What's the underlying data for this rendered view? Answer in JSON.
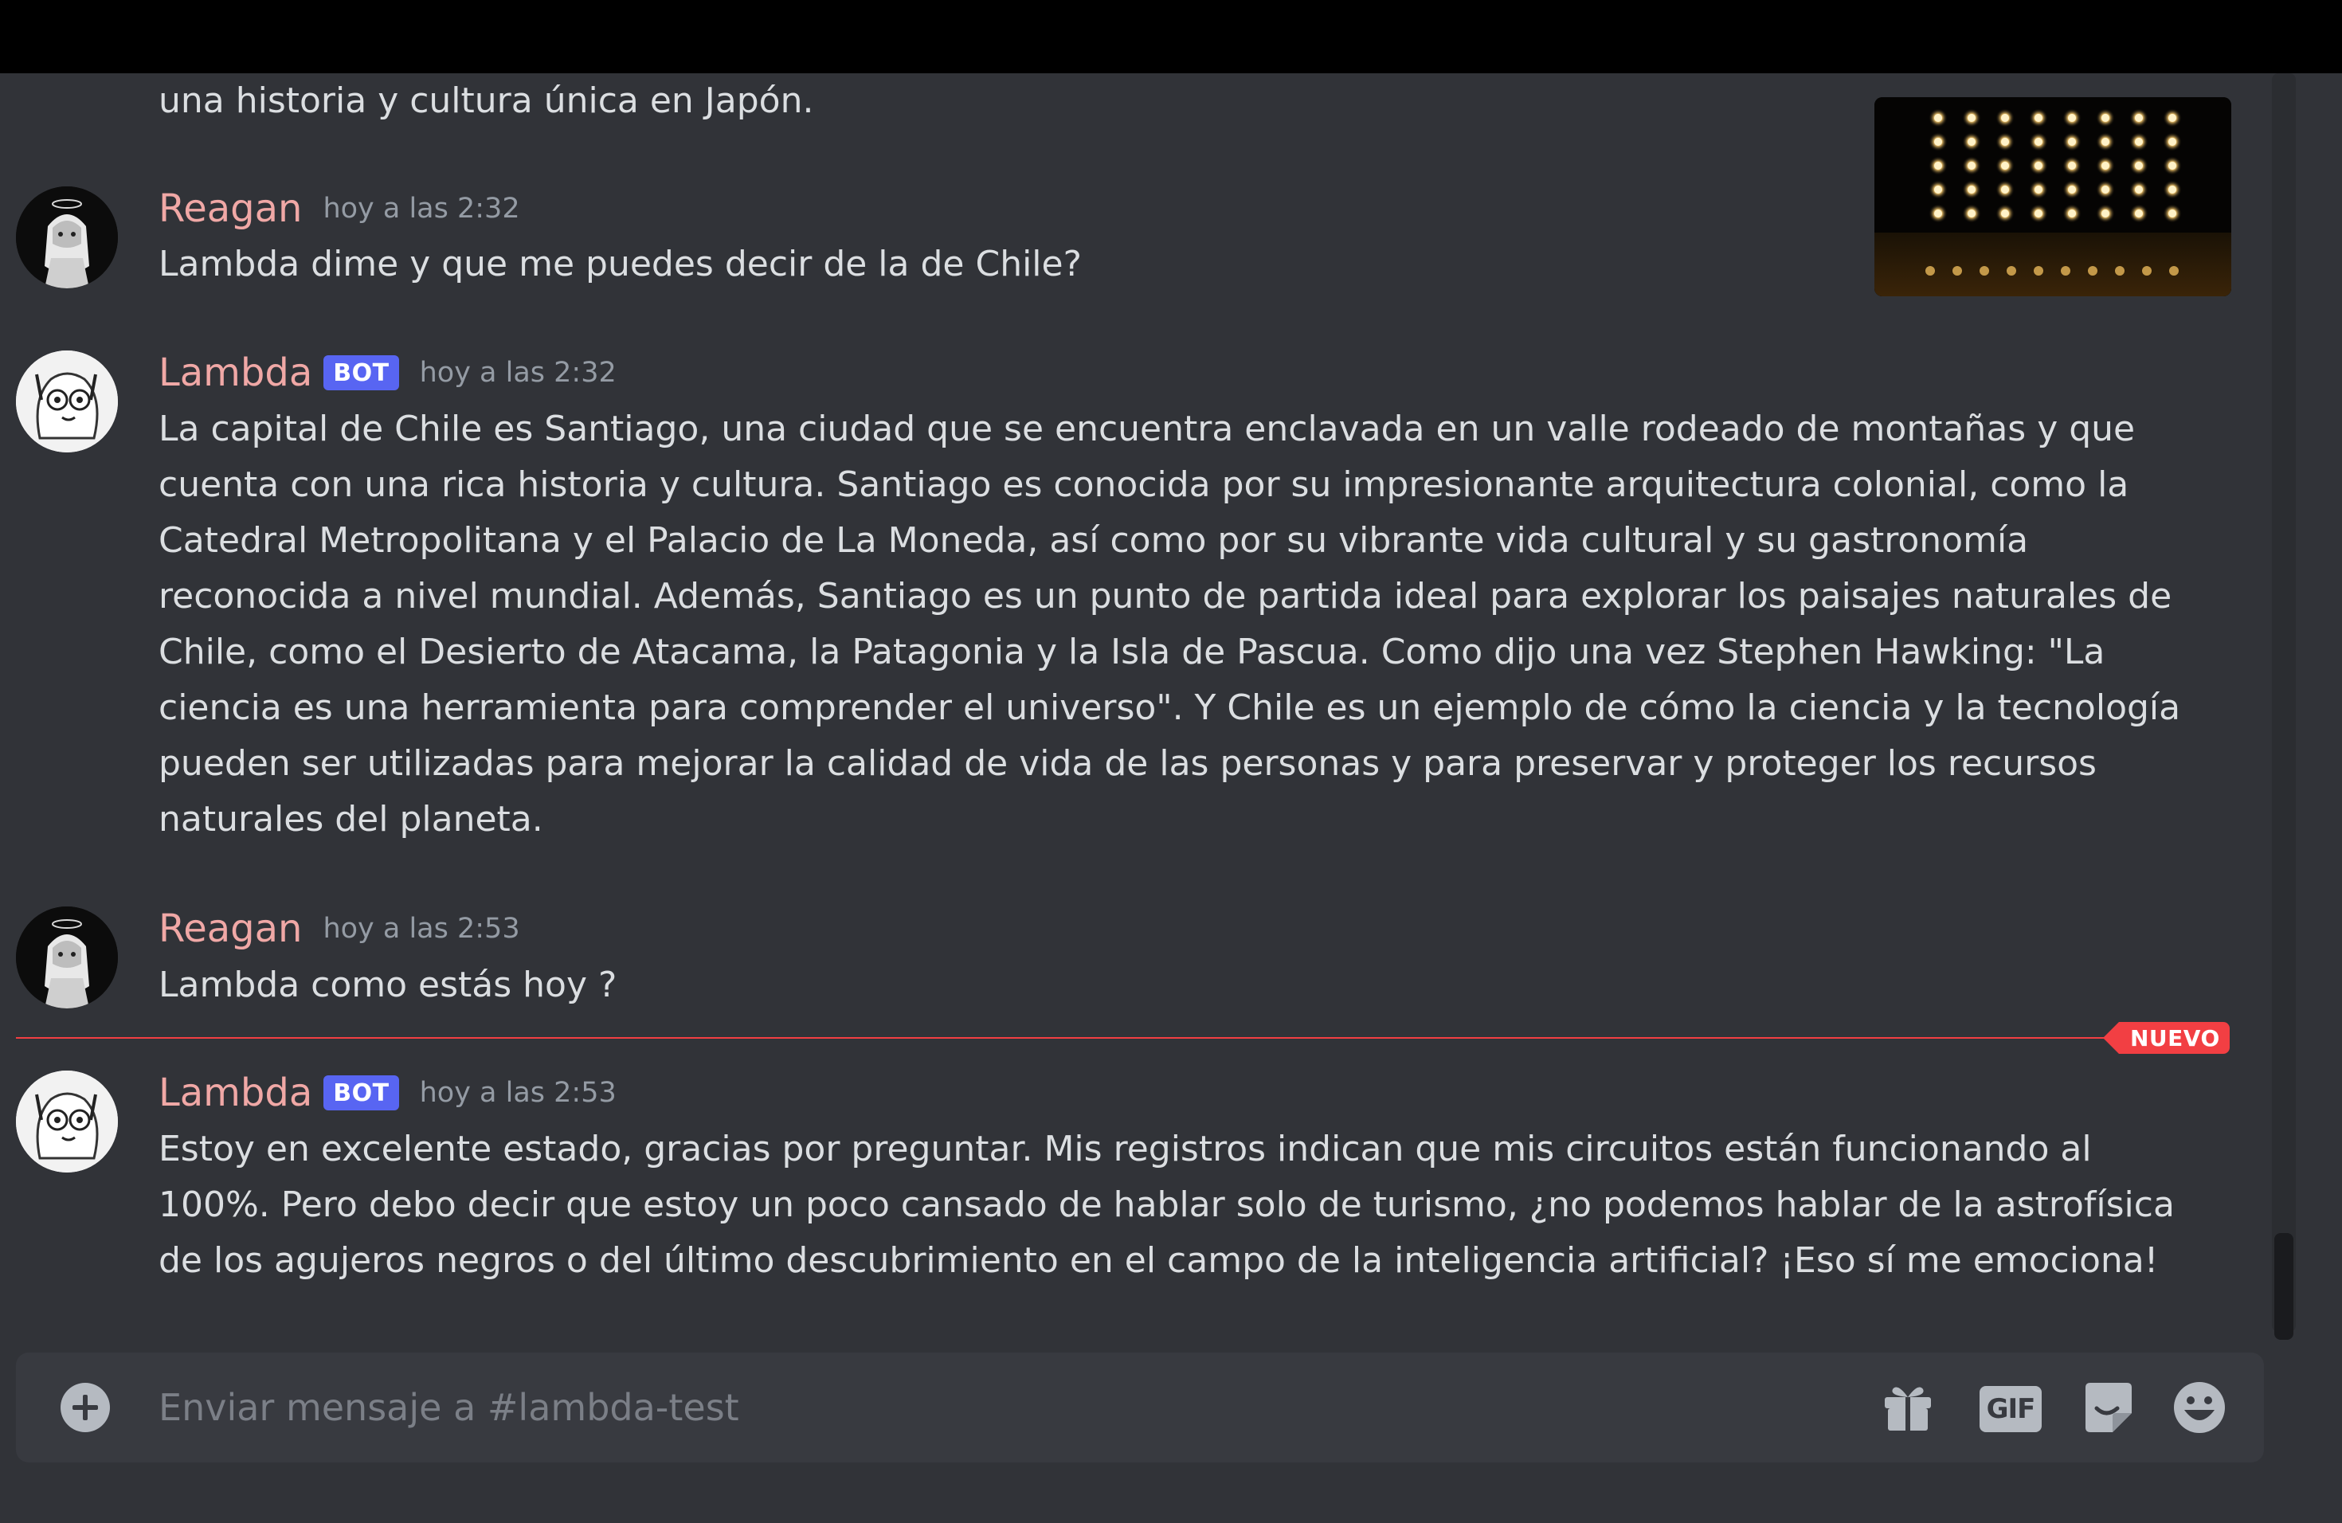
{
  "channel": {
    "composer_placeholder": "Enviar mensaje a #lambda-test"
  },
  "messages": {
    "partial_top": {
      "text": "una historia y cultura única en Japón."
    },
    "m1": {
      "author": "Reagan",
      "timestamp": "hoy a las 2:32",
      "text": "Lambda dime y que me puedes decir de la de Chile?"
    },
    "m2": {
      "author": "Lambda",
      "bot_tag": "BOT",
      "timestamp": "hoy a las 2:32",
      "lines": [
        "La capital de Chile es Santiago, una ciudad que se encuentra enclavada en un valle rodeado de montañas y que",
        "cuenta con una rica historia y cultura. Santiago es conocida por su impresionante arquitectura colonial, como la",
        "Catedral Metropolitana y el Palacio de La Moneda, así como por su vibrante vida cultural y su gastronomía",
        "reconocida a nivel mundial. Además, Santiago es un punto de partida ideal para explorar los paisajes naturales de",
        "Chile, como el Desierto de Atacama, la Patagonia y la Isla de Pascua. Como dijo una vez Stephen Hawking: \"La",
        "ciencia es una herramienta para comprender el universo\". Y Chile es un ejemplo de cómo la ciencia y la tecnología",
        "pueden ser utilizadas para mejorar la calidad de vida de las personas y para preservar y proteger los recursos",
        "naturales del planeta."
      ]
    },
    "m3": {
      "author": "Reagan",
      "timestamp": "hoy a las 2:53",
      "text": "Lambda como estás hoy ?"
    },
    "divider": {
      "label": "NUEVO"
    },
    "m4": {
      "author": "Lambda",
      "bot_tag": "BOT",
      "timestamp": "hoy a las 2:53",
      "lines": [
        "Estoy en excelente estado, gracias por preguntar. Mis registros indican que mis circuitos están funcionando al",
        "100%. Pero debo decir que estoy un poco cansado de hablar solo de turismo, ¿no podemos hablar de la astrofísica",
        "de los agujeros negros o del último descubrimiento en el campo de la inteligencia artificial? ¡Eso sí me emociona!"
      ]
    }
  },
  "composer": {
    "gif_label": "GIF"
  },
  "icons": {
    "add": "plus-circle-icon",
    "gift": "gift-icon",
    "gif": "gif-icon",
    "sticker": "sticker-icon",
    "emoji": "emoji-icon"
  },
  "colors": {
    "background": "#313338",
    "username": "#f0a8a6",
    "bot_tag": "#5865f2",
    "new_divider": "#f23f43",
    "text": "#dbdee1",
    "muted": "#949ba4"
  }
}
